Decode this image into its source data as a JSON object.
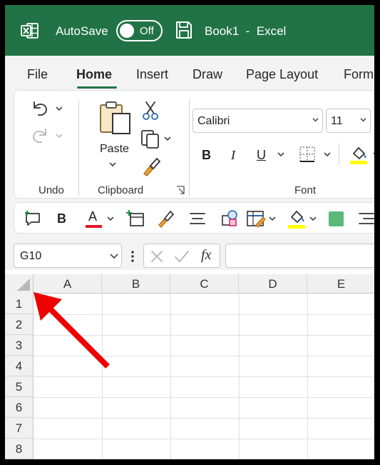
{
  "titlebar": {
    "autosave_label": "AutoSave",
    "autosave_state": "Off",
    "document_title": "Book1  -  Excel",
    "accent_color": "#217346"
  },
  "tabs": [
    {
      "label": "File",
      "active": false
    },
    {
      "label": "Home",
      "active": true
    },
    {
      "label": "Insert",
      "active": false
    },
    {
      "label": "Draw",
      "active": false
    },
    {
      "label": "Page Layout",
      "active": false
    },
    {
      "label": "Form",
      "active": false
    }
  ],
  "ribbon": {
    "groups": {
      "undo": "Undo",
      "clipboard": "Clipboard",
      "font": "Font"
    },
    "paste_label": "Paste",
    "font_name": "Calibri",
    "font_size": "11",
    "format_buttons": {
      "bold": "B",
      "italic": "I",
      "underline": "U"
    },
    "icons": [
      "undo-icon",
      "redo-icon",
      "cut-icon",
      "copy-icon",
      "format-painter-icon",
      "borders-icon",
      "fill-color-icon"
    ]
  },
  "quick_access": {
    "bold": "B",
    "font_color_letter": "A",
    "font_color": "#e81123",
    "highlight_color": "#ffff00",
    "fill_swatch_color": "#5bb978",
    "icons": [
      "new-comment-icon",
      "bold-icon",
      "font-color-icon",
      "insert-icon",
      "format-painter-icon",
      "align-icon",
      "shapes-icon",
      "table-format-icon",
      "fill-color-icon",
      "fill-swatch-icon",
      "align-right-icon"
    ]
  },
  "formula_bar": {
    "name_box": "G10",
    "fx_label": "fx",
    "formula_value": ""
  },
  "grid": {
    "columns": [
      "A",
      "B",
      "C",
      "D",
      "E"
    ],
    "rows": [
      "1",
      "2",
      "3",
      "4",
      "5",
      "6",
      "7",
      "8"
    ]
  },
  "annotation": {
    "arrow_color": "#ee0000",
    "points_to": "select-all-corner"
  }
}
